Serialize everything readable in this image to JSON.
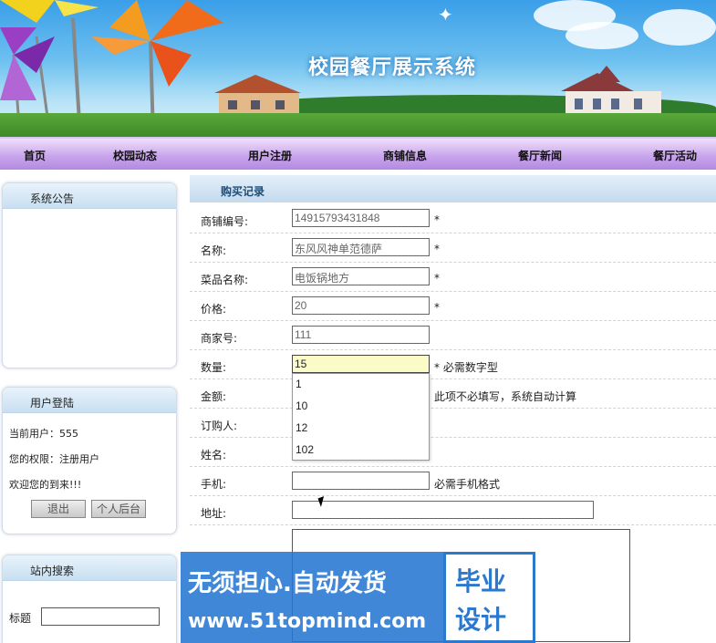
{
  "banner": {
    "title": "校园餐厅展示系统"
  },
  "nav": [
    "首页",
    "校园动态",
    "用户注册",
    "商铺信息",
    "餐厅新闻",
    "餐厅活动"
  ],
  "sidebar": {
    "notice_title": "系统公告",
    "login_title": "用户登陆",
    "current_user": "当前用户：555",
    "permission": "您的权限：注册用户",
    "welcome": "欢迎您的到来!!!",
    "logout_button": "退出",
    "backend_button": "个人后台",
    "search_title": "站内搜索",
    "search_label": "标题"
  },
  "main": {
    "header": "购买记录",
    "rows": [
      {
        "label": "商铺编号:",
        "value": "14915793431848",
        "note": "*"
      },
      {
        "label": "名称:",
        "value": "东风风神单范德萨",
        "note": "*"
      },
      {
        "label": "菜品名称:",
        "value": "电饭锅地方",
        "note": "*"
      },
      {
        "label": "价格:",
        "value": "20",
        "note": "*"
      },
      {
        "label": "商家号:",
        "value": "111",
        "note": ""
      },
      {
        "label": "数量:",
        "value": "15",
        "note": "* 必需数字型"
      },
      {
        "label": "金额:",
        "value": "",
        "note": "此项不必填写，系统自动计算"
      },
      {
        "label": "订购人:",
        "value": "",
        "note": ""
      },
      {
        "label": "姓名:",
        "value": "",
        "note": ""
      },
      {
        "label": "手机:",
        "value": "",
        "note": "必需手机格式"
      },
      {
        "label": "地址:",
        "value": "",
        "note": ""
      }
    ],
    "autocomplete": [
      "1",
      "10",
      "12",
      "102"
    ]
  },
  "watermark": {
    "line1": "无须担心.自动发货",
    "line2": "www.51topmind.com",
    "seal1": "毕业",
    "seal2": "设计"
  },
  "colors": {
    "nav_bg": "#c9a6ec",
    "header_bg": "#c3daee",
    "watermark_bg": "#2678d2"
  }
}
